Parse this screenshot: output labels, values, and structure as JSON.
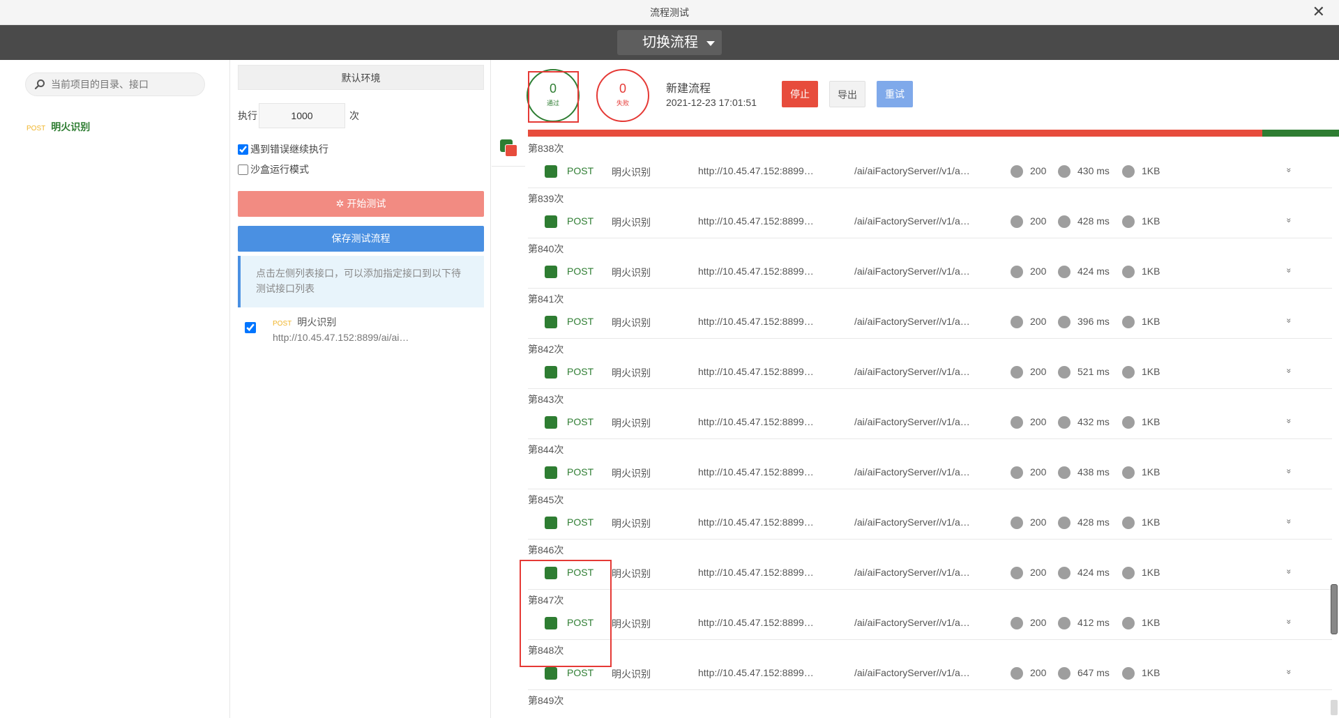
{
  "window": {
    "title": "流程测试"
  },
  "header": {
    "switch_label": "切换流程"
  },
  "left": {
    "search_placeholder": "当前项目的目录、接口",
    "tree_item": {
      "method": "POST",
      "name": "明火识别"
    }
  },
  "middle": {
    "env_label": "默认环境",
    "exec_prefix": "执行",
    "exec_count": "1000",
    "exec_suffix": "次",
    "continue_on_error": {
      "label": "遇到错误继续执行",
      "checked": true
    },
    "sandbox_mode": {
      "label": "沙盒运行模式",
      "checked": false
    },
    "start_button": "开始测试",
    "save_button": "保存测试流程",
    "hint": "点击左侧列表接口，可以添加指定接口到以下待测试接口列表",
    "selected_api": {
      "method": "POST",
      "name": "明火识别",
      "url": "http://10.45.47.152:8899/ai/ai…",
      "checked": true
    }
  },
  "right": {
    "pass": {
      "count": "0",
      "label": "通过"
    },
    "fail": {
      "count": "0",
      "label": "失败"
    },
    "flow_name": "新建流程",
    "flow_time": "2021-12-23 17:01:51",
    "stop_button": "停止",
    "export_button": "导出",
    "retry_button": "重试",
    "progress_fail_fraction": 0.905,
    "colors": {
      "pass": "#2e7d32",
      "fail": "#e74c3c"
    },
    "runs": [
      {
        "label": "第838次",
        "method": "POST",
        "name": "明火识别",
        "host": "http://10.45.47.152:8899…",
        "path": "/ai/aiFactoryServer//v1/a…",
        "status": "200",
        "time": "430 ms",
        "size": "1KB"
      },
      {
        "label": "第839次",
        "method": "POST",
        "name": "明火识别",
        "host": "http://10.45.47.152:8899…",
        "path": "/ai/aiFactoryServer//v1/a…",
        "status": "200",
        "time": "428 ms",
        "size": "1KB"
      },
      {
        "label": "第840次",
        "method": "POST",
        "name": "明火识别",
        "host": "http://10.45.47.152:8899…",
        "path": "/ai/aiFactoryServer//v1/a…",
        "status": "200",
        "time": "424 ms",
        "size": "1KB"
      },
      {
        "label": "第841次",
        "method": "POST",
        "name": "明火识别",
        "host": "http://10.45.47.152:8899…",
        "path": "/ai/aiFactoryServer//v1/a…",
        "status": "200",
        "time": "396 ms",
        "size": "1KB"
      },
      {
        "label": "第842次",
        "method": "POST",
        "name": "明火识别",
        "host": "http://10.45.47.152:8899…",
        "path": "/ai/aiFactoryServer//v1/a…",
        "status": "200",
        "time": "521 ms",
        "size": "1KB"
      },
      {
        "label": "第843次",
        "method": "POST",
        "name": "明火识别",
        "host": "http://10.45.47.152:8899…",
        "path": "/ai/aiFactoryServer//v1/a…",
        "status": "200",
        "time": "432 ms",
        "size": "1KB"
      },
      {
        "label": "第844次",
        "method": "POST",
        "name": "明火识别",
        "host": "http://10.45.47.152:8899…",
        "path": "/ai/aiFactoryServer//v1/a…",
        "status": "200",
        "time": "438 ms",
        "size": "1KB"
      },
      {
        "label": "第845次",
        "method": "POST",
        "name": "明火识别",
        "host": "http://10.45.47.152:8899…",
        "path": "/ai/aiFactoryServer//v1/a…",
        "status": "200",
        "time": "428 ms",
        "size": "1KB"
      },
      {
        "label": "第846次",
        "method": "POST",
        "name": "明火识别",
        "host": "http://10.45.47.152:8899…",
        "path": "/ai/aiFactoryServer//v1/a…",
        "status": "200",
        "time": "424 ms",
        "size": "1KB"
      },
      {
        "label": "第847次",
        "method": "POST",
        "name": "明火识别",
        "host": "http://10.45.47.152:8899…",
        "path": "/ai/aiFactoryServer//v1/a…",
        "status": "200",
        "time": "412 ms",
        "size": "1KB"
      },
      {
        "label": "第848次",
        "method": "POST",
        "name": "明火识别",
        "host": "http://10.45.47.152:8899…",
        "path": "/ai/aiFactoryServer//v1/a…",
        "status": "200",
        "time": "647 ms",
        "size": "1KB"
      }
    ],
    "last_label": "第849次"
  }
}
